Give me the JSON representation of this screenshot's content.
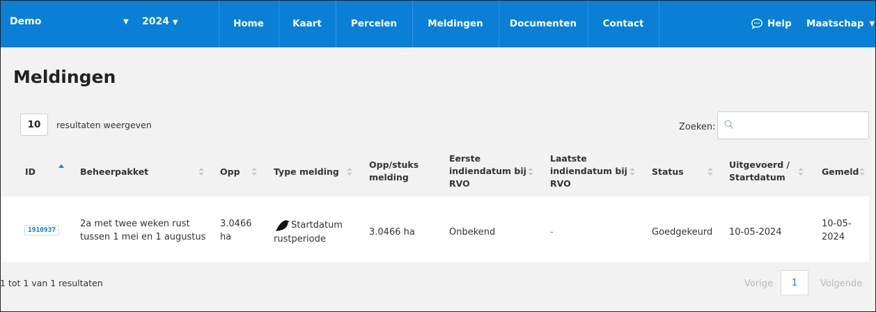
{
  "navbar": {
    "org": "Demo",
    "year": "2024",
    "items": [
      "Home",
      "Kaart",
      "Percelen",
      "Meldingen",
      "Documenten",
      "Contact"
    ],
    "help": "Help",
    "account": "Maatschap"
  },
  "page": {
    "title": "Meldingen"
  },
  "controls": {
    "page_length": "10",
    "page_length_label": "resultaten weergeven",
    "search_label": "Zoeken:",
    "search_value": ""
  },
  "table": {
    "headers": {
      "id": "ID",
      "beheerpakket": "Beheerpakket",
      "opp": "Opp",
      "type": "Type melding",
      "opp_stuks_1": "Opp/stuks",
      "opp_stuks_2": "melding",
      "eerste_1": "Eerste",
      "eerste_2": "indiendatum bij",
      "eerste_3": "RVO",
      "laatste_1": "Laatste",
      "laatste_2": "indiendatum bij",
      "laatste_3": "RVO",
      "status": "Status",
      "uitgevoerd_1": "Uitgevoerd /",
      "uitgevoerd_2": "Startdatum",
      "gemeld": "Gemeld"
    },
    "rows": [
      {
        "id": "1910937",
        "beheerpakket_1": "2a met twee weken rust",
        "beheerpakket_2": "tussen 1 mei en 1 augustus",
        "opp_1": "3.0466",
        "opp_2": "ha",
        "type_icon": "bird-icon",
        "type_1": "Startdatum",
        "type_2": "rustperiode",
        "opp_stuks": "3.0466 ha",
        "eerste": "Onbekend",
        "laatste": "-",
        "status": "Goedgekeurd",
        "uitgevoerd": "10-05-2024",
        "gemeld_1": "10-05-",
        "gemeld_2": "2024"
      }
    ]
  },
  "footer": {
    "info": "1 tot 1 van 1 resultaten",
    "prev": "Vorige",
    "current_page": "1",
    "next": "Volgende"
  },
  "colors": {
    "nav": "#0a7fd6",
    "accent": "#0a7fd6",
    "background": "#f2f2f2"
  }
}
